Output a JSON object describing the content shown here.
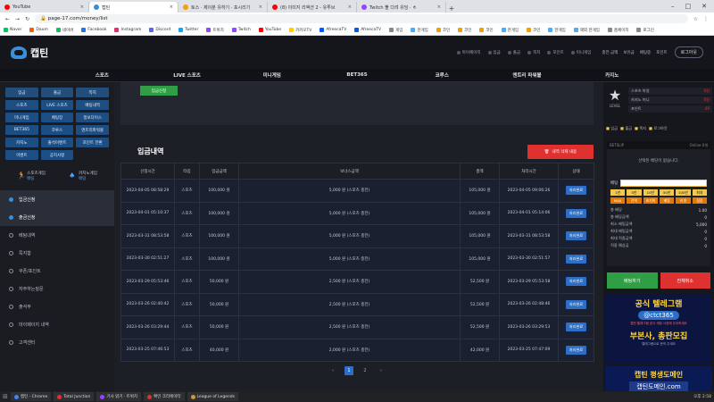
{
  "browser": {
    "tabs": [
      {
        "label": "YouTube",
        "color": "#ff0000",
        "active": false
      },
      {
        "label": "캡틴",
        "color": "#3b8fd9",
        "active": true
      },
      {
        "label": "토스 · 제이분 유하기 · 포시리기",
        "color": "#f59f00",
        "active": false
      },
      {
        "label": "(8) 이미지 리액션 2 - 유투브",
        "color": "#ff0000",
        "active": false
      },
      {
        "label": "Twitch 뿔 다려 유딩 · ㅎ",
        "color": "#9146ff",
        "active": false
      }
    ],
    "url": "page-17.com/money/list",
    "bookmarks": [
      "Naver",
      "Daum",
      "네이버",
      "Facebook",
      "Instagram",
      "Discord",
      "Twitter",
      "트위치",
      "Twitch",
      "YouTube",
      "카카오TV",
      "AfreecaTV",
      "AfreecaTV",
      "게임",
      "한게임",
      "코인",
      "코인",
      "코인",
      "한게임",
      "코인",
      "한게임",
      "해외 한게임",
      "홈페이지",
      "로그인"
    ]
  },
  "site": {
    "logo": "캡틴",
    "header_links": [
      "마이페이지",
      "입금",
      "출금",
      "쪽지",
      "포인트",
      "미니게임"
    ],
    "header_right": [
      "충전 금액",
      "보유금",
      "베팅중",
      "포인트"
    ],
    "logout": "로그아웃"
  },
  "mainnav": [
    "스포츠",
    "LIVE 스포츠",
    "미니게임",
    "BET365",
    "코루스",
    "엔트리 파워볼",
    "카지노"
  ],
  "left": {
    "grid": [
      "입금",
      "출금",
      "쪽지",
      "스포츠",
      "LIVE 스포츠",
      "배팅내역",
      "미니게임",
      "배팅장",
      "정보다이스",
      "BET365",
      "코루스",
      "엔트리파워볼",
      "카지노",
      "출석이벤트",
      "포인트 전환",
      "이벤트",
      "공지사항"
    ],
    "games": [
      {
        "label": "스포츠게임",
        "sub": "배팅"
      },
      {
        "label": "카지노게임",
        "sub": "배팅"
      }
    ],
    "menu": [
      {
        "label": "입금신청",
        "on": true
      },
      {
        "label": "출금신청",
        "on": true
      },
      {
        "label": "베팅내역",
        "on": false
      },
      {
        "label": "쪽지함",
        "on": false
      },
      {
        "label": "쿠폰/포인트",
        "on": false
      },
      {
        "label": "자주하는질문",
        "on": false
      },
      {
        "label": "출석부",
        "on": false
      },
      {
        "label": "마이페이지 내역",
        "on": false
      },
      {
        "label": "고객센터",
        "on": false
      }
    ]
  },
  "main": {
    "apply_button": "입금신청",
    "section_title": "입금내역",
    "delete_button": "내역 삭제 내용",
    "columns": [
      "신청시간",
      "타입",
      "입금금액",
      "보너스금액",
      "총액",
      "처리시간",
      "상태"
    ],
    "rows": [
      [
        "2023-04-05 08:58:29",
        "스포츠",
        "100,000 원",
        "5,000 원 (스포츠 충전)",
        "105,000 원",
        "2023-04-05 09:06:26",
        "처리완료"
      ],
      [
        "2023-04-01 05:10:37",
        "스포츠",
        "100,000 원",
        "5,000 원 (스포츠 충전)",
        "105,000 원",
        "2023-04-01 05:14:06",
        "처리완료"
      ],
      [
        "2023-03-31 08:53:58",
        "스포츠",
        "100,000 원",
        "5,000 원 (스포츠 충전)",
        "105,000 원",
        "2023-03-31 08:53:58",
        "처리완료"
      ],
      [
        "2023-03-30 02:51:27",
        "스포츠",
        "100,000 원",
        "5,000 원 (스포츠 충전)",
        "105,000 원",
        "2023-03-30 02:51:57",
        "처리완료"
      ],
      [
        "2023-03-29 05:53:46",
        "스포츠",
        "50,000 원",
        "2,500 원 (스포츠 충전)",
        "52,500 원",
        "2023-03-29 05:53:58",
        "처리완료"
      ],
      [
        "2023-03-26 02:40:42",
        "스포츠",
        "50,000 원",
        "2,500 원 (스포츠 충전)",
        "52,500 원",
        "2023-03-26 02:48:46",
        "처리완료"
      ],
      [
        "2023-03-26 03:29:44",
        "스포츠",
        "50,000 원",
        "2,500 원 (스포츠 충전)",
        "52,500 원",
        "2023-03-26 03:29:53",
        "처리완료"
      ],
      [
        "2023-03-25 07:46:53",
        "스포츠",
        "40,000 원",
        "2,000 원 (스포츠 충전)",
        "42,000 원",
        "2023-03-25 07:47:09",
        "처리완료"
      ]
    ],
    "pager": [
      "‹",
      "1",
      "2",
      "›"
    ]
  },
  "right": {
    "level": "LEVEL",
    "user_lines": [
      {
        "label": "스포츠 마일",
        "value": "0원"
      },
      {
        "label": "카지노 머니",
        "value": "0원"
      },
      {
        "label": "포인트",
        "value": "0P"
      }
    ],
    "tabs": [
      "입금",
      "출금",
      "쪽지",
      "로그아웃"
    ],
    "betslip_head": "BETSLIP",
    "betslip_right": "Online 0개",
    "betslip_msg": "선택된 배당이 없습니다.",
    "bet_label": "배팅",
    "chips": [
      "1만",
      "5만",
      "10만",
      "50만",
      "100만",
      "최대",
      "MAX",
      "잔액",
      "초기화",
      "베팅",
      "리셋",
      "정정"
    ],
    "lines": [
      {
        "label": "총 배당",
        "value": "1.00"
      },
      {
        "label": "총 배당금액",
        "value": "0"
      },
      {
        "label": "최소 배팅금액",
        "value": "5,000"
      },
      {
        "label": "최대 배팅금액",
        "value": "0"
      },
      {
        "label": "최대 적중금액",
        "value": "0"
      },
      {
        "label": "적중 예상금",
        "value": "0"
      }
    ],
    "buttons": [
      {
        "label": "배팅하기",
        "color": "#2f9e44"
      },
      {
        "label": "전체취소",
        "color": "#e03131"
      }
    ],
    "banner1": {
      "title": "공식 텔레그램",
      "handle": "@ctct365",
      "sub": "캡틴 텔레그램 공식 계정 사칭에 주의하세요",
      "title2": "부본사, 총판모집",
      "sub2": "텔레그램으로 문의 주세요"
    },
    "banner2": {
      "title": "캡틴 평생도메인",
      "domain": "캡틴도메인.com"
    }
  },
  "taskbar": [
    "캡틴 - Chrome",
    "Total Junction",
    "기사 읽기 · 트위치",
    "확인 크리에이터",
    "League of Legends"
  ],
  "taskbar_time": "오후 2:58"
}
